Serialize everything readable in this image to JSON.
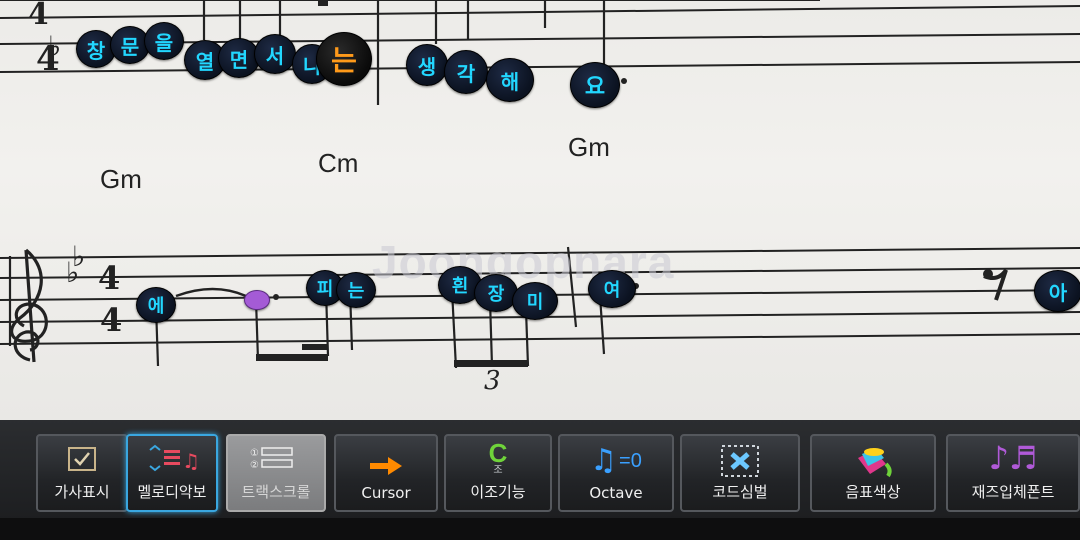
{
  "watermark": "Joongopnara",
  "score": {
    "top_chords": [],
    "chords": [
      "Gm",
      "Cm",
      "Gm"
    ],
    "top_time_signature": {
      "num": "4",
      "den": "4"
    },
    "time_signature": {
      "num": "4",
      "den": "4"
    },
    "triplet": "3",
    "top_lyrics": [
      "창",
      "문",
      "을",
      "열",
      "면",
      "서",
      "니",
      "는",
      "생",
      "각",
      "해",
      "요"
    ],
    "bottom_lyrics": [
      "에",
      "",
      "피",
      "는",
      "흰",
      "장",
      "미",
      "여",
      "아"
    ]
  },
  "toolbar": {
    "buttons": [
      {
        "label": "가사표시",
        "icon": "checkbox-icon"
      },
      {
        "label": "멜로디악보",
        "icon": "melody-score-icon"
      },
      {
        "label": "트랙스크롤",
        "icon": "track-scroll-icon"
      },
      {
        "label": "Cursor",
        "icon": "arrow-right-icon"
      },
      {
        "label": "이조기능",
        "icon": "transpose-icon",
        "icon_text": "C",
        "icon_sub": "조"
      },
      {
        "label": "Octave",
        "icon": "octave-icon",
        "icon_text": "=0"
      },
      {
        "label": "코드심벌",
        "icon": "chord-symbol-icon"
      },
      {
        "label": "음표색상",
        "icon": "paint-bucket-icon"
      },
      {
        "label": "재즈입체폰트",
        "icon": "jazz-font-icon"
      }
    ]
  },
  "colors": {
    "lyric_text": "#22d7ff",
    "lyric_highlight": "#ff9a1a",
    "note_purple": "#a45bd6",
    "active_border": "#3aa7e0",
    "cursor_arrow": "#ff8a00",
    "transpose_green": "#6fd33a",
    "octave_blue": "#3aa0ff"
  }
}
